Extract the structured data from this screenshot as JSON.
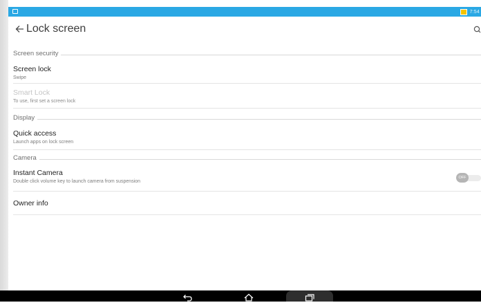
{
  "status_bar": {
    "time": "7:54",
    "accent_color": "#2aa8e4",
    "battery_color": "#f5c400"
  },
  "header": {
    "title": "Lock screen",
    "back_icon": "arrow-back-icon",
    "search_icon": "search-icon"
  },
  "sections": {
    "screen_security": {
      "label": "Screen security",
      "screen_lock": {
        "title": "Screen lock",
        "summary": "Swipe"
      },
      "smart_lock": {
        "title": "Smart Lock",
        "summary": "To use, first set a screen lock"
      }
    },
    "display": {
      "label": "Display",
      "quick_access": {
        "title": "Quick access",
        "summary": "Launch apps on lock screen"
      }
    },
    "camera": {
      "label": "Camera",
      "instant_camera": {
        "title": "Instant Camera",
        "summary": "Double click volume key to launch camera from suspension",
        "toggle_state": "OFF"
      },
      "owner_info": {
        "title": "Owner info"
      }
    }
  },
  "nav_bar": {
    "back_icon": "nav-back-icon",
    "home_icon": "nav-home-icon",
    "recents_icon": "nav-recents-icon"
  }
}
